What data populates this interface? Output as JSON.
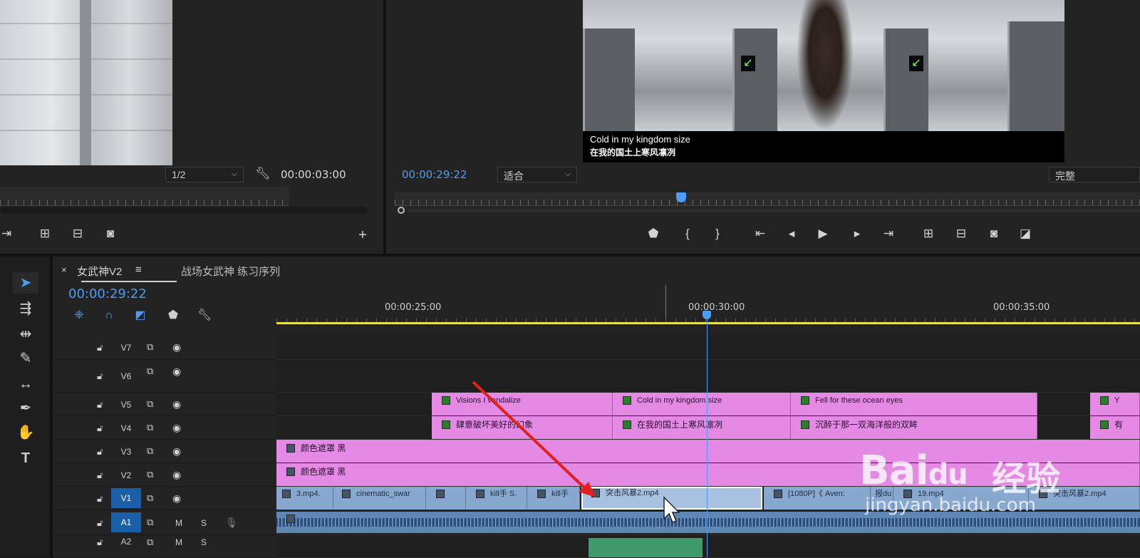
{
  "source_monitor": {
    "zoom": "1/2",
    "duration": "00:00:03:00"
  },
  "program_monitor": {
    "timecode": "00:00:29:22",
    "fit": "适合",
    "quality": "完整",
    "subtitle_en": "Cold in my kingdom size",
    "subtitle_cn": "在我的国土上寒风凛冽"
  },
  "timeline": {
    "tabs": [
      {
        "label": "女武神V2"
      },
      {
        "label": "战场女武神 练习序列"
      }
    ],
    "tab_close": "×",
    "tab_menu": "≡",
    "timecode": "00:00:29:22",
    "ruler_labels": [
      "00:00:25:00",
      "00:00:30:00",
      "00:00:35:00"
    ],
    "tracks": [
      {
        "name": "V7"
      },
      {
        "name": "V6"
      },
      {
        "name": "V5"
      },
      {
        "name": "V4"
      },
      {
        "name": "V3"
      },
      {
        "name": "V2"
      },
      {
        "name": "V1"
      },
      {
        "name": "A1"
      },
      {
        "name": "A2"
      }
    ],
    "audio_buttons": {
      "mute": "M",
      "solo": "S"
    },
    "clips": {
      "v5": [
        "Visions I vandalize",
        "Cold in my kingdom size",
        "Fell for these ocean eyes",
        "Y"
      ],
      "v4": [
        "肆意破坏美好的幻象",
        "在我的国土上寒风凛冽",
        "沉醉于那一双海洋般的双眸",
        "有"
      ],
      "v3": [
        "颜色遮罩 黑"
      ],
      "v2": [
        "颜色遮罩 黑"
      ],
      "v1": [
        "3.mp4.",
        "cinematic_swar",
        "",
        "kill手 S.",
        "kill手",
        "突击风暴2.mp4",
        "[1080P]《 Aven:",
        "报du",
        "19.mp4",
        "突击风暴2.mp4"
      ]
    }
  },
  "watermark": {
    "logo": "Bai",
    "logo_du": "du",
    "cn": "经验",
    "url": "jingyan.baidu.com"
  },
  "colors": {
    "accent": "#4d9cf5",
    "clip_pink": "#e48ae4",
    "clip_blue": "#89a8d0",
    "work_area": "#e8e24a",
    "annotation": "#e0201a"
  }
}
